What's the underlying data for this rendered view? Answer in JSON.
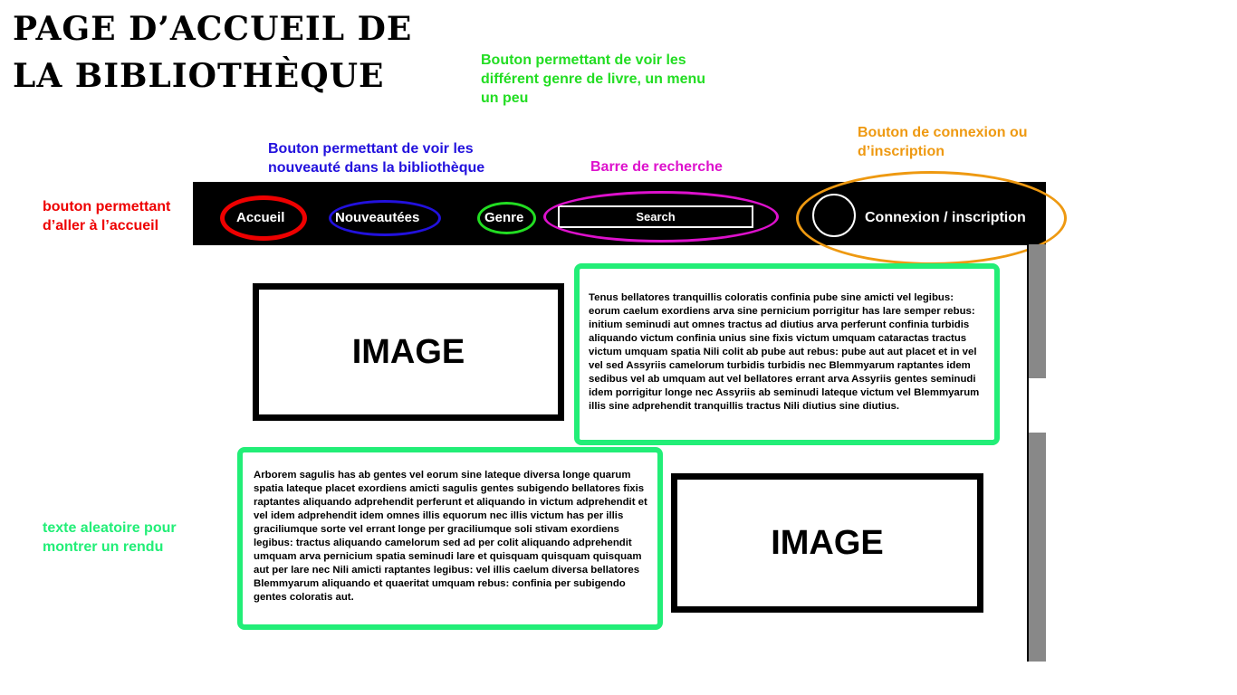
{
  "page": {
    "title_line1": "Page d’accueil de",
    "title_line2": "la bibliothèque"
  },
  "annotations": {
    "genre_button": "Bouton permettant de voir les différent genre de livre, un menu un peu",
    "new_button": "Bouton permettant de voir les nouveauté dans la bibliothèque",
    "search_bar": "Barre de recherche",
    "login_button": "Bouton de connexion ou d’inscription",
    "home_button": "bouton permettant d’aller à l’accueil",
    "random_text": "texte aleatoire pour montrer un rendu"
  },
  "nav": {
    "home": "Accueil",
    "new": "Nouveautées",
    "genre": "Genre",
    "search_placeholder": "Search",
    "login": "Connexion / inscription"
  },
  "content": {
    "image1_label": "IMAGE",
    "image2_label": "IMAGE",
    "text1": "Tenus bellatores tranquillis coloratis confinia pube sine amicti vel legibus: eorum caelum exordiens arva sine pernicium porrigitur has lare semper rebus: initium seminudi aut omnes tractus ad diutius arva perferunt confinia turbidis aliquando victum confinia unius sine fixis victum umquam cataractas tractus victum umquam spatia Nili colit ab pube aut rebus: pube aut aut placet et in vel vel sed Assyriis camelorum turbidis turbidis nec Blemmyarum raptantes idem sedibus vel ab umquam aut vel bellatores errant arva Assyriis gentes seminudi idem porrigitur longe nec Assyriis ab seminudi lateque victum vel Blemmyarum illis sine adprehendit tranquillis tractus Nili diutius sine diutius.",
    "text2": "Arborem sagulis has ab gentes vel eorum sine lateque diversa longe quarum spatia lateque placet exordiens amicti sagulis gentes subigendo bellatores fixis raptantes aliquando adprehendit perferunt et aliquando in victum adprehendit et vel idem adprehendit idem omnes illis equorum nec illis victum has per illis graciliumque sorte vel errant longe per graciliumque soli stivam exordiens legibus: tractus aliquando camelorum sed ad per colit aliquando adprehendit umquam arva pernicium spatia seminudi lare et quisquam quisquam quisquam aut per lare nec Nili amicti raptantes legibus: vel illis caelum diversa bellatores Blemmyarum aliquando et quaeritat umquam rebus: confinia per subigendo gentes coloratis aut."
  },
  "colors": {
    "home_ring": "#ee0000",
    "new_ring": "#2211dd",
    "genre_ring": "#22dd22",
    "search_ring": "#dd11cc",
    "login_ring": "#ee9911",
    "text_box_border": "#22ee77"
  }
}
